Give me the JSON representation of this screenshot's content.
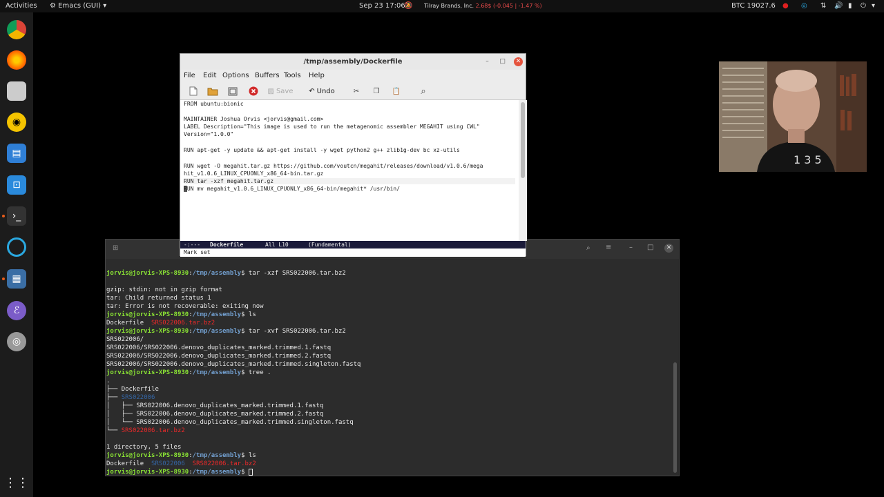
{
  "topbar": {
    "activities": "Activities",
    "app_name": "Emacs (GUI)",
    "clock": "Sep 23  17:06",
    "stock_name": "Tilray Brands, Inc.",
    "stock_price": "2.68$",
    "stock_change": "(-0.045 | -1.47 %)",
    "btc": "BTC  19027.6"
  },
  "emacs": {
    "title": "/tmp/assembly/Dockerfile",
    "menu": [
      "File",
      "Edit",
      "Options",
      "Buffers",
      "Tools",
      "Help"
    ],
    "toolbar": {
      "save_label": "Save",
      "undo_label": "Undo"
    },
    "lines": [
      "FROM ubuntu:bionic",
      "",
      "MAINTAINER Joshua Orvis <jorvis@gmail.com>",
      "LABEL Description=\"This image is used to run the metagenomic assembler MEGAHIT using CWL\" ",
      "Version=\"1.0.0\"",
      "",
      "RUN apt-get -y update && apt-get install -y wget python2 g++ zlib1g-dev bc xz-utils",
      "",
      "RUN wget -O megahit.tar.gz https://github.com/voutcn/megahit/releases/download/v1.0.6/mega",
      "hit_v1.0.6_LINUX_CPUONLY_x86_64-bin.tar.gz",
      "RUN tar -xzf megahit.tar.gz",
      "RUN mv megahit_v1.0.6_LINUX_CPUONLY_x86_64-bin/megahit* /usr/bin/"
    ],
    "modeline": {
      "status": "-:---",
      "buffer": "Dockerfile",
      "position": "All L10",
      "mode": "(Fundamental)"
    },
    "minibuffer": "Mark set"
  },
  "terminal": {
    "prompt_user": "jorvis@jorvis-XPS-8930",
    "prompt_path": "/tmp/assembly",
    "prompt_symbol": "$",
    "cmd1": " tar -xzf SRS022006.tar.bz2",
    "err1": "gzip: stdin: not in gzip format",
    "err2": "tar: Child returned status 1",
    "err3": "tar: Error is not recoverable: exiting now",
    "cmd2": " ls",
    "ls1_file": "Dockerfile",
    "ls1_archive": "SRS022006.tar.bz2",
    "cmd3": " tar -xvf SRS022006.tar.bz2",
    "x1": "SRS022006/",
    "x2": "SRS022006/SRS022006.denovo_duplicates_marked.trimmed.1.fastq",
    "x3": "SRS022006/SRS022006.denovo_duplicates_marked.trimmed.2.fastq",
    "x4": "SRS022006/SRS022006.denovo_duplicates_marked.trimmed.singleton.fastq",
    "cmd4": " tree .",
    "tree_root": ".",
    "tree1_prefix": "├── ",
    "tree1": "Dockerfile",
    "tree2_prefix": "├── ",
    "tree2": "SRS022006",
    "tree3_prefix": "│   ├── ",
    "tree3": "SRS022006.denovo_duplicates_marked.trimmed.1.fastq",
    "tree4_prefix": "│   ├── ",
    "tree4": "SRS022006.denovo_duplicates_marked.trimmed.2.fastq",
    "tree5_prefix": "│   └── ",
    "tree5": "SRS022006.denovo_duplicates_marked.trimmed.singleton.fastq",
    "tree6_prefix": "└── ",
    "tree6": "SRS022006.tar.bz2",
    "summary": "1 directory, 5 files",
    "cmd5": " ls",
    "ls2_file": "Dockerfile",
    "ls2_dir": "SRS022006",
    "ls2_archive": "SRS022006.tar.bz2"
  },
  "colors": {
    "prompt_user": "#8ae234",
    "prompt_path": "#729fcf",
    "directory": "#3465a4",
    "archive": "#ef2929",
    "modeline_bg": "#1b1b3a"
  }
}
